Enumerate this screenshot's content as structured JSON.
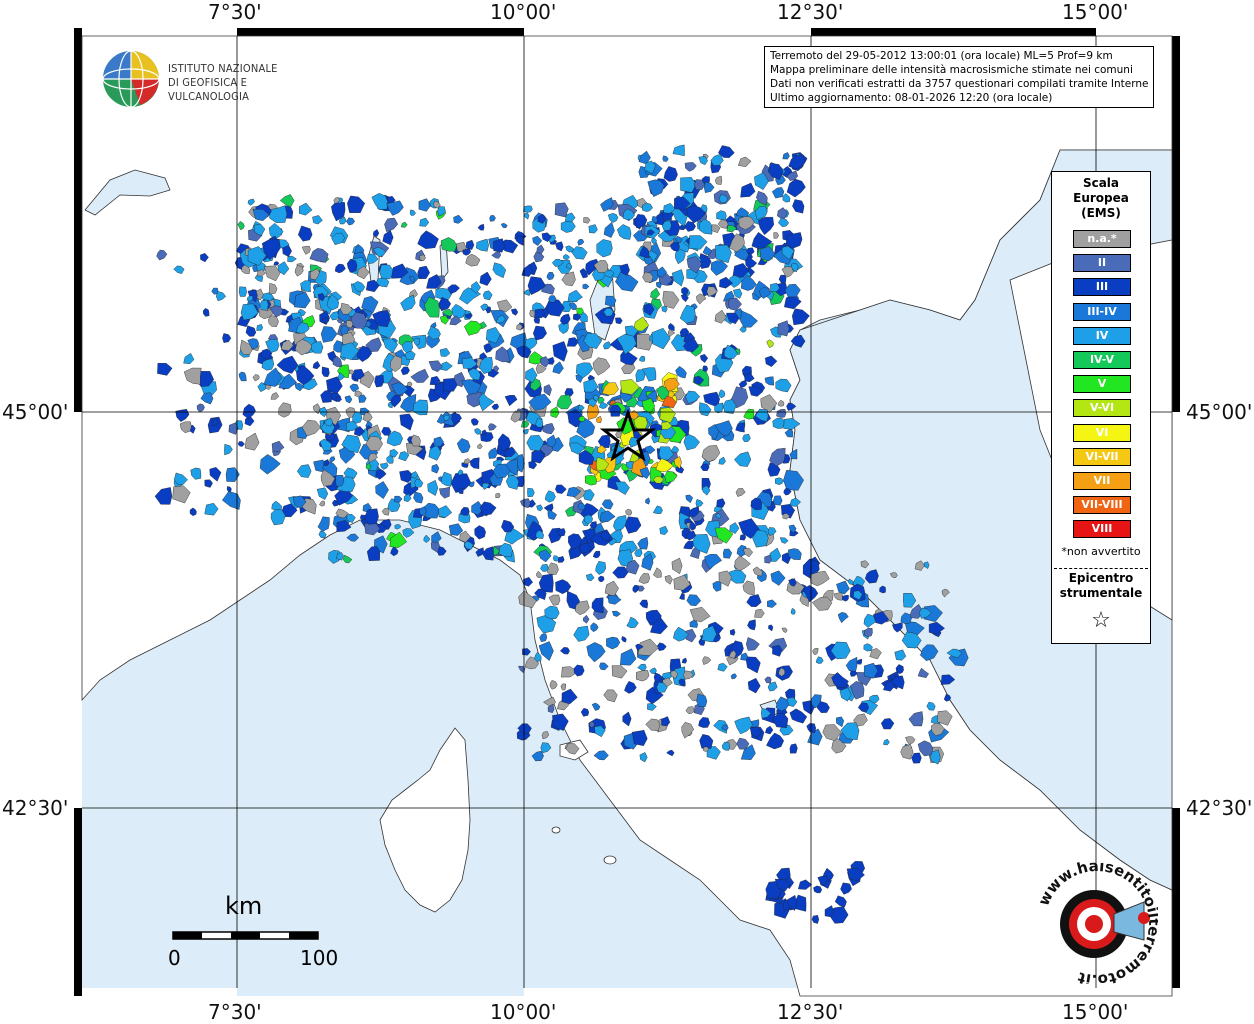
{
  "info": {
    "line1": "Terremoto del 29-05-2012 13:00:01 (ora locale) ML=5 Prof=9 km",
    "line2": "Mappa preliminare delle intensità macrosismiche stimate nei comuni",
    "line3": "Dati non verificati estratti da 3757 questionari compilati tramite Internet.",
    "line4": "Ultimo aggiornamento: 08-01-2026 12:20 (ora locale)"
  },
  "logo": {
    "line1": "ISTITUTO NAZIONALE",
    "line2": "DI GEOFISICA E VULCANOLOGIA"
  },
  "axes": {
    "top": [
      "7°30'",
      "10°00'",
      "12°30'",
      "15°00'"
    ],
    "bottom": [
      "7°30'",
      "10°00'",
      "12°30'",
      "15°00'"
    ],
    "left": [
      "45°00'",
      "42°30'"
    ],
    "right": [
      "45°00'",
      "42°30'"
    ]
  },
  "legend": {
    "title1": "Scala",
    "title2": "Europea",
    "title3": "(EMS)",
    "items": [
      {
        "label": "n.a.*",
        "color": "#a0a0a0"
      },
      {
        "label": "II",
        "color": "#4a6bb8"
      },
      {
        "label": "III",
        "color": "#0a3ec2"
      },
      {
        "label": "III-IV",
        "color": "#1a78d8"
      },
      {
        "label": "IV",
        "color": "#1ea0e8"
      },
      {
        "label": "IV-V",
        "color": "#14c85a"
      },
      {
        "label": "V",
        "color": "#22e622"
      },
      {
        "label": "V-VI",
        "color": "#b4e614"
      },
      {
        "label": "VI",
        "color": "#f5f514"
      },
      {
        "label": "VI-VII",
        "color": "#f5c814"
      },
      {
        "label": "VII",
        "color": "#f5a014"
      },
      {
        "label": "VII-VIII",
        "color": "#f06414"
      },
      {
        "label": "VIII",
        "color": "#e61414"
      }
    ],
    "note": "*non avvertito",
    "epi1": "Epicentro",
    "epi2": "strumentale",
    "epi_symbol": "☆"
  },
  "scalebar": {
    "unit": "km",
    "start": "0",
    "end": "100"
  },
  "stamp": {
    "text": "www.haisentitoilterremoto.it"
  },
  "colors": {
    "sea": "#dcecf8",
    "land": "#ffffff",
    "frame": "#000000"
  }
}
